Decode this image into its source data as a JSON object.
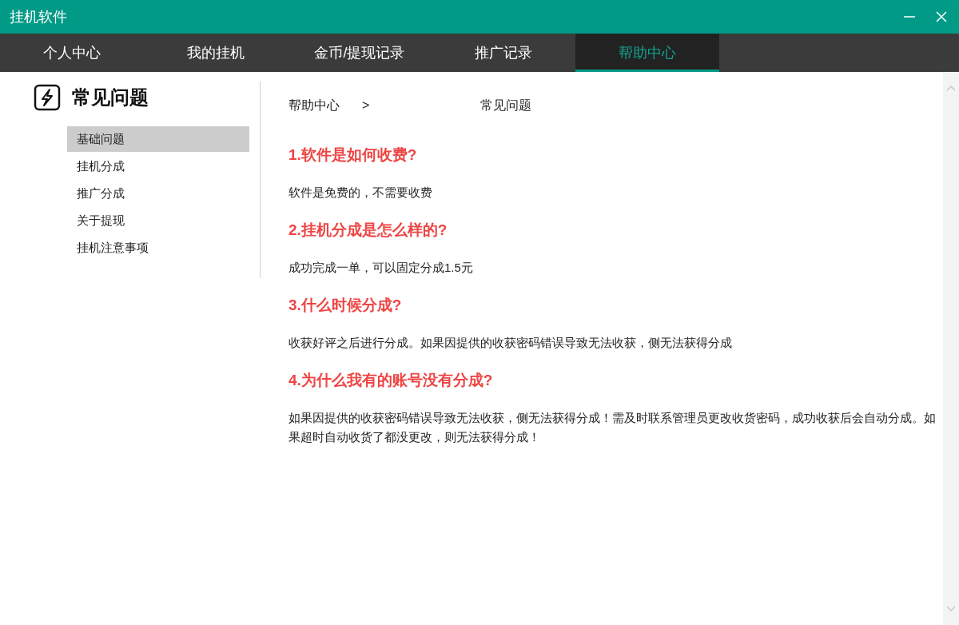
{
  "window": {
    "title": "挂机软件"
  },
  "tabs": [
    {
      "label": "个人中心",
      "selected": false
    },
    {
      "label": "我的挂机",
      "selected": false
    },
    {
      "label": "金币/提现记录",
      "selected": false
    },
    {
      "label": "推广记录",
      "selected": false
    },
    {
      "label": "帮助中心",
      "selected": true
    }
  ],
  "sidebar": {
    "title": "常见问题",
    "items": [
      {
        "label": "基础问题",
        "selected": true
      },
      {
        "label": "挂机分成",
        "selected": false
      },
      {
        "label": "推广分成",
        "selected": false
      },
      {
        "label": "关于提现",
        "selected": false
      },
      {
        "label": "挂机注意事项",
        "selected": false
      }
    ]
  },
  "breadcrumb": {
    "parent": "帮助中心",
    "separator": ">",
    "current": "常见问题"
  },
  "faq": [
    {
      "question": "1.软件是如何收费?",
      "answer": "软件是免费的，不需要收费"
    },
    {
      "question": "2.挂机分成是怎么样的?",
      "answer": "成功完成一单，可以固定分成1.5元"
    },
    {
      "question": "3.什么时候分成?",
      "answer": "收获好评之后进行分成。如果因提供的收获密码错误导致无法收获，侧无法获得分成"
    },
    {
      "question": "4.为什么我有的账号没有分成?",
      "answer": "如果因提供的收获密码错误导致无法收获，侧无法获得分成！需及时联系管理员更改收货密码，成功收获后会自动分成。如果超时自动收货了都没更改，则无法获得分成！"
    }
  ]
}
